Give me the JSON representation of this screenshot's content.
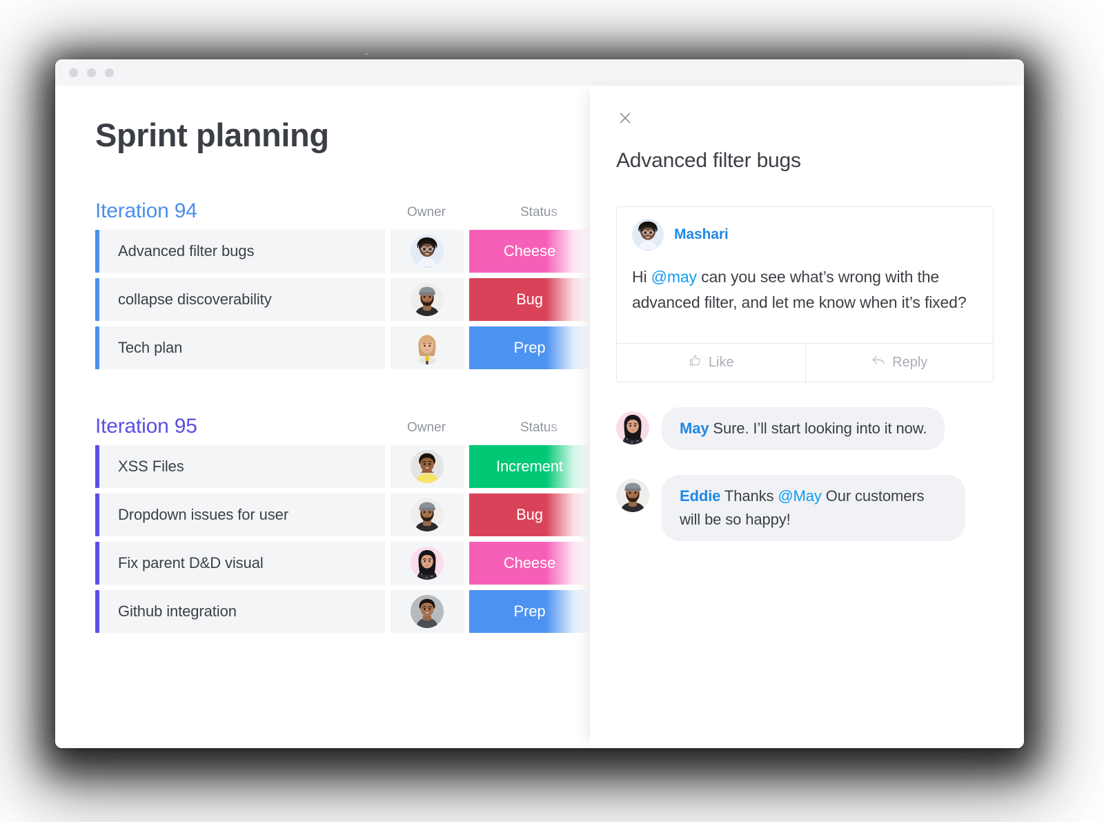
{
  "window": {
    "traffic_lights": [
      "close",
      "minimize",
      "maximize"
    ]
  },
  "board": {
    "page_title": "Sprint planning",
    "columns": {
      "owner": "Owner",
      "status": "Status"
    },
    "sections": [
      {
        "title": "Iteration 94",
        "accent": "#4a90e8",
        "rows": [
          {
            "title": "Advanced filter bugs",
            "owner_avatar": "woman-glasses-afro",
            "status": "Cheese",
            "status_color": "#f65fb8"
          },
          {
            "title": "collapse discoverability",
            "owner_avatar": "man-beanie-beard",
            "status": "Bug",
            "status_color": "#d9435a"
          },
          {
            "title": "Tech plan",
            "owner_avatar": "woman-blonde-mic",
            "status": "Prep",
            "status_color": "#4c92f0"
          }
        ]
      },
      {
        "title": "Iteration 95",
        "accent": "#5a4fe4",
        "rows": [
          {
            "title": "XSS Files",
            "owner_avatar": "woman-yellow-top",
            "status": "Increment",
            "status_color": "#00c875"
          },
          {
            "title": "Dropdown issues for user",
            "owner_avatar": "man-beanie-beard",
            "status": "Bug",
            "status_color": "#d9435a"
          },
          {
            "title": "Fix parent D&D visual",
            "owner_avatar": "woman-dark-hair",
            "status": "Cheese",
            "status_color": "#f65fb8"
          },
          {
            "title": "Github integration",
            "owner_avatar": "woman-short-hair",
            "status": "Prep",
            "status_color": "#4c92f0"
          }
        ]
      }
    ]
  },
  "panel": {
    "close_label": "×",
    "title": "Advanced filter bugs",
    "main_comment": {
      "author": "Mashari",
      "avatar": "woman-glasses-afro",
      "text_prefix": "Hi ",
      "mention": "@may",
      "text_suffix": " can you see what’s wrong with the advanced filter, and let me know when it’s fixed?",
      "like_label": "Like",
      "reply_label": "Reply"
    },
    "replies": [
      {
        "author": "May",
        "avatar": "woman-dark-hair",
        "text": " Sure. I’ll start looking into it now.",
        "mention": "",
        "text_after": ""
      },
      {
        "author": "Eddie",
        "avatar": "man-beanie-beard",
        "text": " Thanks ",
        "mention": "@May",
        "text_after": " Our customers will be so happy!"
      }
    ]
  },
  "colors": {
    "accent_blue": "#4a90e8",
    "accent_purple": "#5a4fe4",
    "link_blue": "#1f88e5",
    "mention_blue": "#0f9bf5",
    "row_bg": "#f4f5f7",
    "text_dark": "#3b3f45",
    "text_muted": "#8f949c"
  }
}
